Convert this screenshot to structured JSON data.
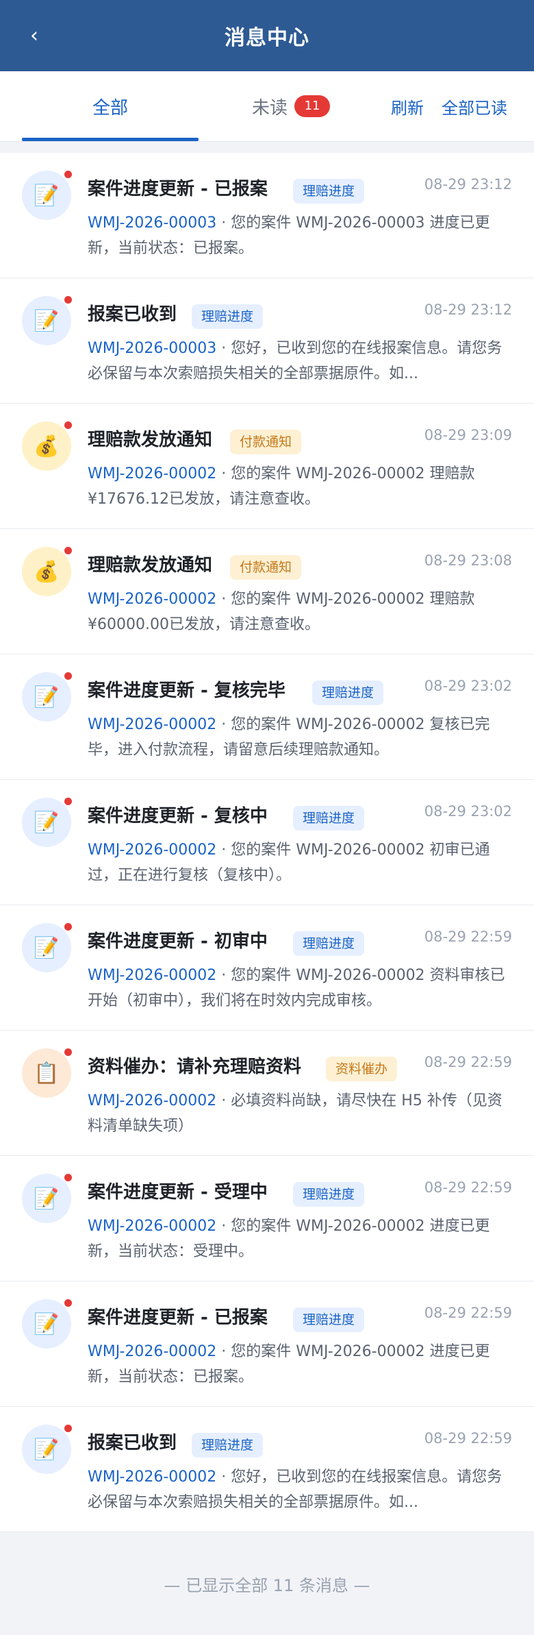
{
  "header": {
    "back_icon": "‹",
    "title": "消息中心"
  },
  "tabs": {
    "all": "全部",
    "unread": "未读",
    "unread_count": "11",
    "refresh": "刷新",
    "mark_all_read": "全部已读"
  },
  "messages": [
    {
      "title": "案件进度更新 - 已报案",
      "tag": "理赔进度",
      "time": "08-29 23:12",
      "case_id": "WMJ-2026-00003",
      "text": " · 您的案件 WMJ-2026-00003 进度已更新，当前状态：已报案。"
    },
    {
      "title": "报案已收到",
      "tag": "理赔进度",
      "time": "08-29 23:12",
      "case_id": "WMJ-2026-00003",
      "text": " · 您好，已收到您的在线报案信息。请您务必保留与本次索赔损失相关的全部票据原件。如..."
    },
    {
      "title": "理赔款发放通知",
      "tag": "付款通知",
      "time": "08-29 23:09",
      "case_id": "WMJ-2026-00002",
      "text": " · 您的案件 WMJ-2026-00002 理赔款 ¥17676.12已发放，请注意查收。"
    },
    {
      "title": "理赔款发放通知",
      "tag": "付款通知",
      "time": "08-29 23:08",
      "case_id": "WMJ-2026-00002",
      "text": " · 您的案件 WMJ-2026-00002 理赔款 ¥60000.00已发放，请注意查收。"
    },
    {
      "title": "案件进度更新 - 复核完毕",
      "tag": "理赔进度",
      "time": "08-29 23:02",
      "case_id": "WMJ-2026-00002",
      "text": " · 您的案件 WMJ-2026-00002 复核已完毕，进入付款流程，请留意后续理赔款通知。"
    },
    {
      "title": "案件进度更新 - 复核中",
      "tag": "理赔进度",
      "time": "08-29 23:02",
      "case_id": "WMJ-2026-00002",
      "text": " · 您的案件 WMJ-2026-00002 初审已通过，正在进行复核（复核中）。"
    },
    {
      "title": "案件进度更新 - 初审中",
      "tag": "理赔进度",
      "time": "08-29 22:59",
      "case_id": "WMJ-2026-00002",
      "text": " · 您的案件 WMJ-2026-00002 资料审核已开始（初审中），我们将在时效内完成审核。"
    },
    {
      "title": "资料催办：请补充理赔资料",
      "tag": "资料催办",
      "time": "08-29 22:59",
      "case_id": "WMJ-2026-00002",
      "text": " · 必填资料尚缺，请尽快在 H5 补传（见资料清单缺失项）"
    },
    {
      "title": "案件进度更新 - 受理中",
      "tag": "理赔进度",
      "time": "08-29 22:59",
      "case_id": "WMJ-2026-00002",
      "text": " · 您的案件 WMJ-2026-00002 进度已更新，当前状态：受理中。"
    },
    {
      "title": "案件进度更新 - 已报案",
      "tag": "理赔进度",
      "time": "08-29 22:59",
      "case_id": "WMJ-2026-00002",
      "text": " · 您的案件 WMJ-2026-00002 进度已更新，当前状态：已报案。"
    },
    {
      "title": "报案已收到",
      "tag": "理赔进度",
      "time": "08-29 22:59",
      "case_id": "WMJ-2026-00002",
      "text": " · 您好，已收到您的在线报案信息。请您务必保留与本次索赔损失相关的全部票据原件。如..."
    }
  ],
  "icons": {
    "memo": "📝",
    "money_bag": "💰",
    "clipboard": "📋"
  },
  "footer": {
    "text": "— 已显示全部 11 条消息 —"
  }
}
